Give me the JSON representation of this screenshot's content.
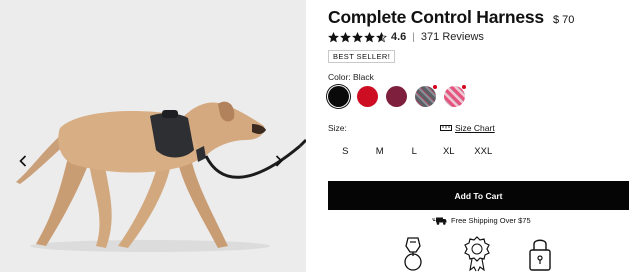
{
  "product": {
    "title": "Complete Control Harness",
    "price": "$ 70"
  },
  "rating": {
    "value": "4.6",
    "stars": 4.6,
    "separator": "|",
    "reviews_label": "371 Reviews"
  },
  "badge": "BEST SELLER!",
  "color": {
    "label": "Color: Black",
    "swatches": [
      {
        "name": "black",
        "hex": "#0a0a0a",
        "selected": true
      },
      {
        "name": "red",
        "hex": "#cc0d22"
      },
      {
        "name": "burgundy",
        "hex": "#7d1f3d"
      },
      {
        "name": "gray-pattern",
        "hex": "#666a72"
      },
      {
        "name": "pink-pattern",
        "hex": "#e35c86"
      }
    ]
  },
  "size": {
    "label": "Size:",
    "chart_label": "Size Chart",
    "options": [
      "S",
      "M",
      "L",
      "XL",
      "XXL"
    ]
  },
  "cart": {
    "button_label": "Add To Cart"
  },
  "shipping": {
    "label": "Free Shipping Over $75"
  },
  "icons": {
    "prev": "chevron-left-icon",
    "next": "chevron-right-icon",
    "ruler": "ruler-icon",
    "truck": "truck-icon",
    "features": [
      "clip-icon",
      "award-ribbon-icon",
      "lock-icon"
    ]
  }
}
